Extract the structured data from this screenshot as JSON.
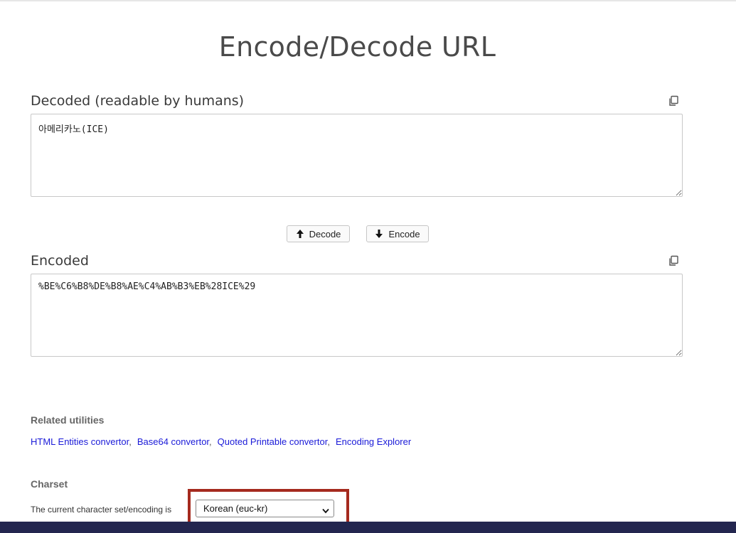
{
  "page": {
    "title": "Encode/Decode URL"
  },
  "decoded": {
    "label": "Decoded (readable by humans)",
    "value": "아메리카노(ICE)",
    "copy_icon": "copy-icon"
  },
  "buttons": {
    "decode_label": "Decode",
    "decode_icon": "arrow-up-icon",
    "encode_label": "Encode",
    "encode_icon": "arrow-down-icon"
  },
  "encoded": {
    "label": "Encoded",
    "value": "%BE%C6%B8%DE%B8%AE%C4%AB%B3%EB%28ICE%29",
    "copy_icon": "copy-icon"
  },
  "related": {
    "heading": "Related utilities",
    "links": [
      "HTML Entities convertor",
      "Base64 convertor",
      "Quoted Printable convertor",
      "Encoding Explorer"
    ],
    "separator": ","
  },
  "charset": {
    "heading": "Charset",
    "description": "The current character set/encoding is",
    "selected": "Korean (euc-kr)"
  },
  "colors": {
    "highlight_border": "#a52a1e",
    "footer": "#23264f",
    "link": "#1a1ad8"
  }
}
